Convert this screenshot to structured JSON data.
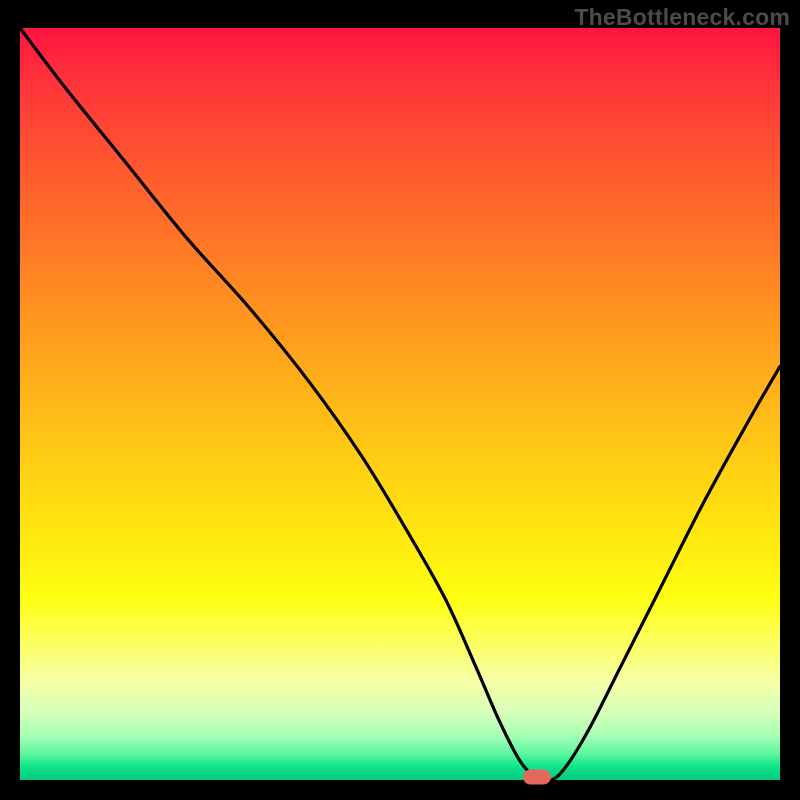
{
  "watermark": "TheBottleneck.com",
  "chart_data": {
    "type": "line",
    "title": "",
    "xlabel": "",
    "ylabel": "",
    "xlim": [
      0,
      100
    ],
    "ylim": [
      0,
      100
    ],
    "x": [
      0,
      6,
      14,
      22,
      30,
      38,
      45,
      51,
      56,
      60,
      63,
      65.5,
      67,
      68,
      70,
      72,
      75,
      79,
      84,
      90,
      96,
      100
    ],
    "values": [
      100,
      92,
      82,
      72,
      63,
      53,
      43,
      33,
      24,
      15,
      8,
      3,
      1,
      0,
      0,
      2,
      7,
      15,
      25,
      37,
      48,
      55
    ],
    "marker": {
      "x": 68,
      "y": 0
    },
    "gradient_top_color": "#ff1340",
    "gradient_bottom_color": "#06ce80"
  }
}
